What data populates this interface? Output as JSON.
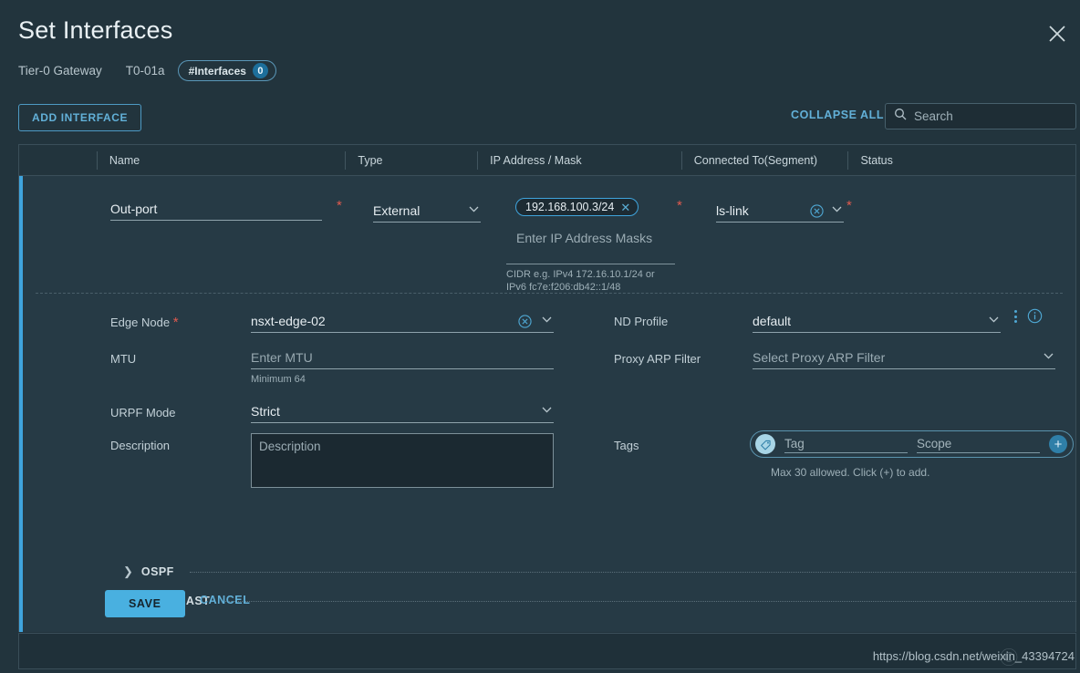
{
  "header": {
    "title": "Set Interfaces",
    "close_icon": "close-icon",
    "breadcrumb": {
      "gateway_label": "Tier-0 Gateway",
      "gateway_name": "T0-01a",
      "badge_label": "#Interfaces",
      "badge_count": "0"
    }
  },
  "toolbar": {
    "add_interface_label": "ADD INTERFACE",
    "collapse_all_label": "COLLAPSE ALL",
    "search_placeholder": "Search",
    "search_value": "",
    "search_icon": "search-icon"
  },
  "table": {
    "columns": [
      "",
      "Name",
      "Type",
      "IP Address / Mask",
      "Connected To(Segment)",
      "Status"
    ]
  },
  "interface": {
    "name_value": "Out-port",
    "name_placeholder": "",
    "type_value": "External",
    "ip_chip": "192.168.100.3/24",
    "ip_placeholder": "Enter IP Address Masks",
    "ip_hint_line1": "CIDR e.g. IPv4 172.16.10.1/24 or",
    "ip_hint_line2": "IPv6 fc7e:f206:db42::1/48",
    "connected_to_value": "ls-link",
    "edge_node_label": "Edge Node",
    "edge_node_value": "nsxt-edge-02",
    "mtu_label": "MTU",
    "mtu_placeholder": "Enter MTU",
    "mtu_hint": "Minimum 64",
    "urpf_label": "URPF Mode",
    "urpf_value": "Strict",
    "description_label": "Description",
    "description_placeholder": "Description",
    "description_value": "",
    "nd_profile_label": "ND Profile",
    "nd_profile_value": "default",
    "proxy_arp_label": "Proxy ARP Filter",
    "proxy_arp_placeholder": "Select Proxy ARP Filter",
    "tags_label": "Tags",
    "tag_placeholder": "Tag",
    "scope_placeholder": "Scope",
    "tag_value": "",
    "scope_value": "",
    "tags_hint": "Max 30 allowed. Click (+) to add.",
    "tag_icon": "tag-icon",
    "add_tag_icon": "plus-icon",
    "kebab_icon": "kebab-menu-icon",
    "info_icon": "info-icon",
    "required_marker": "*"
  },
  "sections": [
    {
      "label": "OSPF",
      "expanded": false
    },
    {
      "label": "MULTICAST",
      "expanded": false
    }
  ],
  "actions": {
    "save_label": "SAVE",
    "cancel_label": "CANCEL"
  },
  "footer": {
    "watermark": "https://blog.csdn.net/weixin_43394724"
  },
  "colors": {
    "accent": "#3fa4dd",
    "panel_bg": "#263a45",
    "app_bg": "#22343d",
    "required": "#e05a4f",
    "save_bg": "#49b0e0"
  }
}
